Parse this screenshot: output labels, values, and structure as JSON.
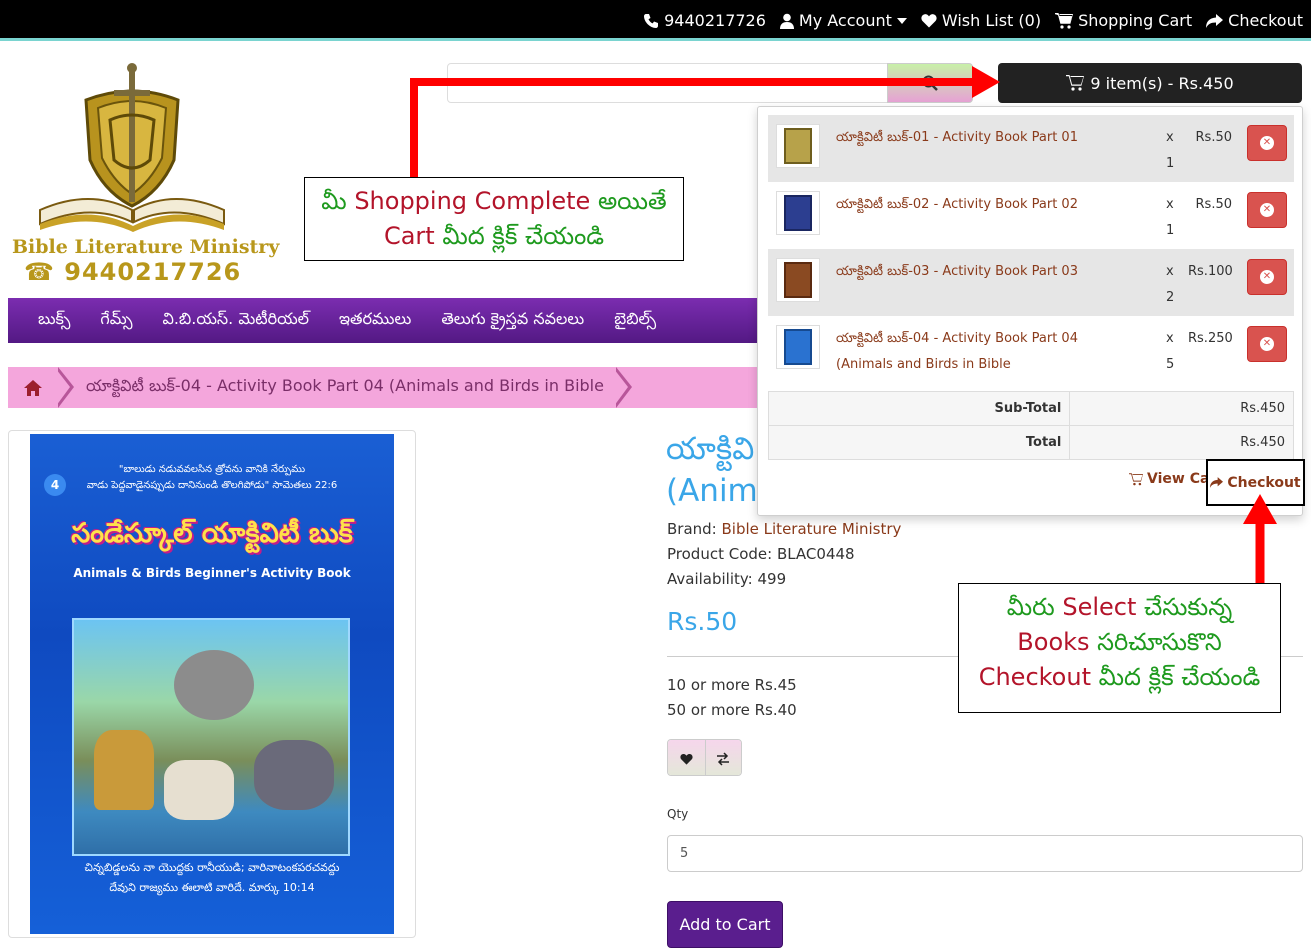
{
  "topbar": {
    "phone": "9440217726",
    "my_account": "My Account",
    "wish_list": "Wish List (0)",
    "shopping_cart": "Shopping Cart",
    "checkout": "Checkout"
  },
  "logo": {
    "name": "Bible Literature Ministry",
    "phone": "☎ 9440217726"
  },
  "cart_button": {
    "label": "9 item(s) - Rs.450"
  },
  "cart_items": [
    {
      "name": "యాక్టివిటీ బుక్-01 - Activity Book Part 01",
      "times": "x",
      "qty": "1",
      "price": "Rs.50",
      "thumb_color": "#b7a24a"
    },
    {
      "name": "యాక్టివిటీ బుక్-02 - Activity Book Part 02",
      "times": "x",
      "qty": "1",
      "price": "Rs.50",
      "thumb_color": "#2c3e90"
    },
    {
      "name": "యాక్టివిటీ బుక్-03 - Activity Book Part 03",
      "times": "x",
      "qty": "2",
      "price": "Rs.100",
      "thumb_color": "#8a4a22"
    },
    {
      "name": "యాక్టివిటీ బుక్-04 - Activity Book Part 04 (Animals and Birds in Bible",
      "times": "x",
      "qty": "5",
      "price": "Rs.250",
      "thumb_color": "#2a72d0"
    }
  ],
  "cart_totals": {
    "subtotal_label": "Sub-Total",
    "subtotal_value": "Rs.450",
    "total_label": "Total",
    "total_value": "Rs.450",
    "view_cart": "View Cart",
    "checkout": "Checkout"
  },
  "nav": {
    "items": [
      "బుక్స్",
      "గేమ్స్",
      "వి.బి.యస్. మెటీరియల్",
      "ఇతరములు",
      "తెలుగు క్రైస్తవ నవలలు",
      "బైబిల్స్"
    ]
  },
  "breadcrumb": {
    "current": "యాక్టివిటీ బుక్-04 - Activity Book Part 04 (Animals and Birds in Bible"
  },
  "cover": {
    "number": "4",
    "verse_top_1": "\"బాలుడు నడువవలసిన త్రోవను వానికి నేర్పుము",
    "verse_top_2": "వాడు పెద్దవాడైనప్పుడు దానినుండి తొలగిపోడు\" సామెతలు 22:6",
    "title": "సండేస్కూల్ యాక్టివిటీ బుక్",
    "subtitle": "Animals & Birds Beginner's Activity Book",
    "verse_bottom_1": "చిన్నబిడ్డలను నా యొద్దకు రానీయుడి; వారినాటంకపరచవద్దు",
    "verse_bottom_2": "దేవుని రాజ్యము ఈలాటి వారిదే. మార్కు 10:14"
  },
  "product": {
    "title_line1": "యాక్టివి",
    "title_line2": "(Anima",
    "brand_label": "Brand:",
    "brand_value": "Bible Literature Ministry",
    "code": "Product Code: BLAC0448",
    "availability": "Availability: 499",
    "price": "Rs.50",
    "discount_1": "10 or more Rs.45",
    "discount_2": "50 or more Rs.40",
    "qty_label": "Qty",
    "qty_value": "5",
    "add_to_cart": "Add to Cart"
  },
  "annotations": {
    "callout1_a1": "మీ ",
    "callout1_a2": "Shopping Complete",
    "callout1_a3": " అయితే",
    "callout1_b1": "Cart",
    "callout1_b2": " మీద క్లిక్ చేయండి",
    "callout2_a1": "మీరు ",
    "callout2_a2": "Select",
    "callout2_a3": " చేసుకున్న",
    "callout2_b1": "Books",
    "callout2_b2": " సరిచూసుకొని",
    "callout2_c1": "Checkout",
    "callout2_c2": " మీద క్లిక్ చేయండి"
  },
  "colors": {
    "accent_purple": "#5a1e8e",
    "price_blue": "#3aa6e8",
    "link_brown": "#8a3a1a",
    "remove_red": "#d9534f",
    "arrow_red": "#ff0000"
  }
}
